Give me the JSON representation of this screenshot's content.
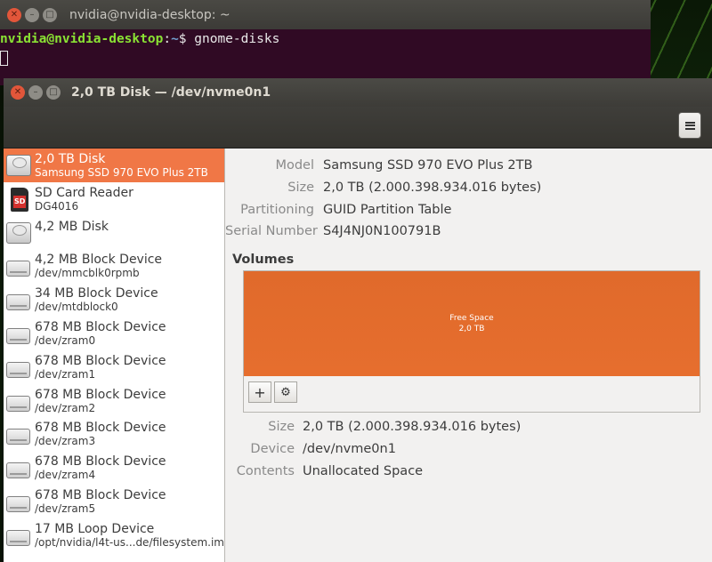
{
  "terminal": {
    "title": "nvidia@nvidia-desktop: ~",
    "prompt_user": "nvidia@nvidia-desktop",
    "prompt_sep": ":",
    "prompt_path": "~",
    "prompt_dollar": "$ ",
    "command": "gnome-disks"
  },
  "disks_window": {
    "title": "2,0 TB Disk — /dev/nvme0n1",
    "menu_icon": "hamburger-menu-icon"
  },
  "sidebar": {
    "items": [
      {
        "name": "2,0 TB Disk",
        "detail": "Samsung SSD 970 EVO Plus 2TB",
        "icon": "hard-disk-icon",
        "selected": true
      },
      {
        "name": "SD Card Reader",
        "detail": "DG4016",
        "icon": "sd-card-icon"
      },
      {
        "name": "4,2 MB Disk",
        "detail": "",
        "icon": "hard-disk-icon"
      },
      {
        "name": "4,2 MB Block Device",
        "detail": "/dev/mmcblk0rpmb",
        "icon": "drive-icon"
      },
      {
        "name": "34 MB Block Device",
        "detail": "/dev/mtdblock0",
        "icon": "drive-icon"
      },
      {
        "name": "678 MB Block Device",
        "detail": "/dev/zram0",
        "icon": "drive-icon"
      },
      {
        "name": "678 MB Block Device",
        "detail": "/dev/zram1",
        "icon": "drive-icon"
      },
      {
        "name": "678 MB Block Device",
        "detail": "/dev/zram2",
        "icon": "drive-icon"
      },
      {
        "name": "678 MB Block Device",
        "detail": "/dev/zram3",
        "icon": "drive-icon"
      },
      {
        "name": "678 MB Block Device",
        "detail": "/dev/zram4",
        "icon": "drive-icon"
      },
      {
        "name": "678 MB Block Device",
        "detail": "/dev/zram5",
        "icon": "drive-icon"
      },
      {
        "name": "17 MB Loop Device",
        "detail": "/opt/nvidia/l4t-us...de/filesystem.img",
        "icon": "drive-icon"
      }
    ]
  },
  "disk_info": {
    "model_label": "Model",
    "model": "Samsung SSD 970 EVO Plus 2TB",
    "size_label": "Size",
    "size": "2,0 TB (2.000.398.934.016 bytes)",
    "partitioning_label": "Partitioning",
    "partitioning": "GUID Partition Table",
    "serial_label": "Serial Number",
    "serial": "S4J4NJ0N100791B"
  },
  "volumes": {
    "title": "Volumes",
    "segment_name": "Free Space",
    "segment_size": "2,0 TB",
    "add_button_icon": "plus-icon",
    "settings_button_icon": "gears-icon",
    "size_label": "Size",
    "size": "2,0 TB (2.000.398.934.016 bytes)",
    "device_label": "Device",
    "device": "/dev/nvme0n1",
    "contents_label": "Contents",
    "contents": "Unallocated Space"
  },
  "colors": {
    "terminal_bg": "#300a24",
    "selection": "#f07746",
    "free_space": "#e36b2c",
    "titlebar": "#3c3b37"
  }
}
